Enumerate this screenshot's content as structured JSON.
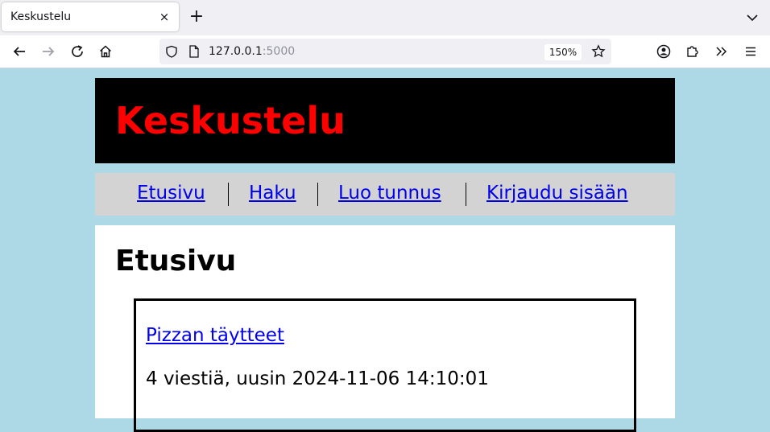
{
  "browser": {
    "tab_title": "Keskustelu",
    "tab_close": "×",
    "new_tab": "+",
    "url_host": "127.0.0.1",
    "url_port": ":5000",
    "zoom": "150%"
  },
  "site": {
    "title": "Keskustelu",
    "nav": [
      "Etusivu",
      "Haku",
      "Luo tunnus",
      "Kirjaudu sisään"
    ]
  },
  "main": {
    "heading": "Etusivu",
    "threads": [
      {
        "title": "Pizzan täytteet",
        "info": "4 viestiä, uusin 2024-11-06 14:10:01"
      }
    ]
  },
  "colors": {
    "page_background": "#add8e6",
    "header_background": "#000000",
    "title_color": "#ff0000",
    "nav_background": "#d3d3d3",
    "link_color": "#0000ee"
  }
}
